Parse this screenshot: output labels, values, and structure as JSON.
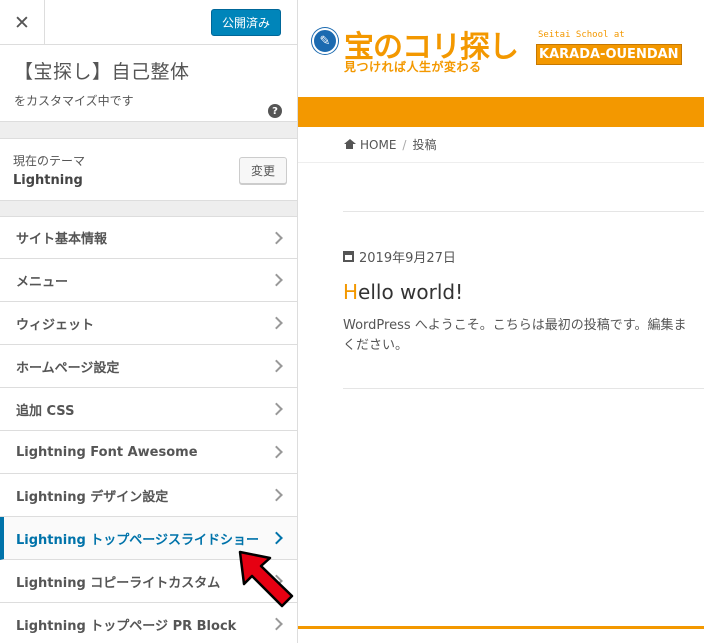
{
  "sidebar": {
    "close_glyph": "✕",
    "publish_label": "公開済み",
    "info_title": "【宝探し】自己整体",
    "info_subtitle": "をカスタマイズ中です",
    "help_glyph": "?",
    "theme_label": "現在のテーマ",
    "theme_name": "Lightning",
    "change_label": "変更",
    "menu_items": [
      {
        "label": "サイト基本情報"
      },
      {
        "label": "メニュー"
      },
      {
        "label": "ウィジェット"
      },
      {
        "label": "ホームページ設定"
      },
      {
        "label": "追加 CSS"
      },
      {
        "label": "Lightning Font Awesome"
      },
      {
        "label": "Lightning デザイン設定"
      },
      {
        "label": "Lightning トップページスライドショー"
      },
      {
        "label": "Lightning コピーライトカスタム"
      },
      {
        "label": "Lightning トップページ PR Block"
      }
    ],
    "active_index": 7
  },
  "preview": {
    "logo": {
      "pencil_glyph": "✎",
      "main_text": "宝のコリ探し",
      "tagline": "見つければ人生が変わる",
      "school_text": "Seitai School at",
      "karada_text": "KARADA-OUENDAN"
    },
    "breadcrumb": {
      "home": "HOME",
      "separator": "/",
      "current": "投稿"
    },
    "post": {
      "date": "2019年9月27日",
      "title_first": "H",
      "title_rest": "ello world!",
      "excerpt_line1": "WordPress へようこそ。こちらは最初の投稿です。編集ま",
      "excerpt_line2": "ください。"
    }
  },
  "colors": {
    "accent_orange": "#f39800",
    "wp_blue": "#0073aa",
    "publish_blue": "#0085ba",
    "annotation_red": "#e60012"
  }
}
